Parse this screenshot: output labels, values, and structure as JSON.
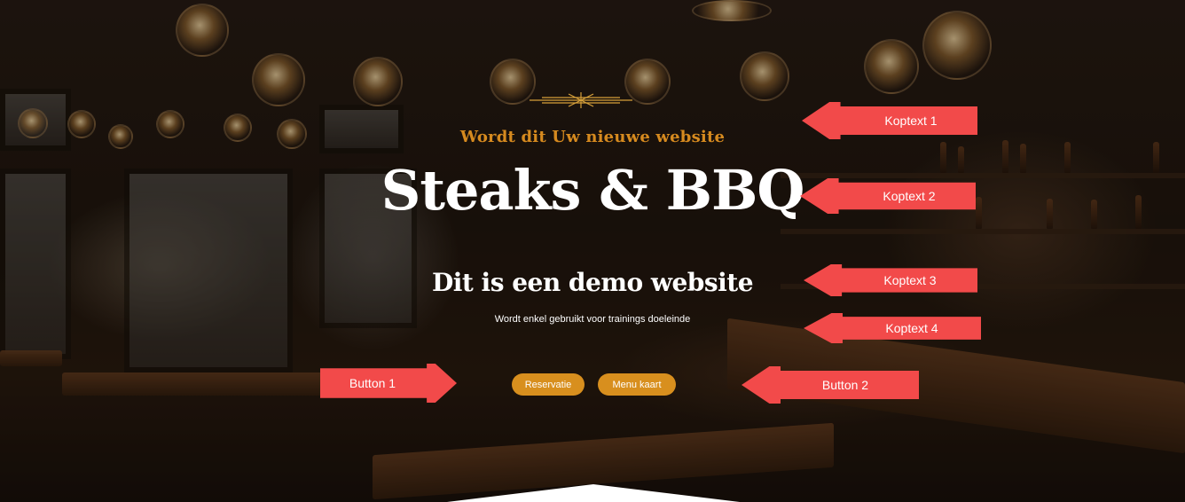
{
  "hero": {
    "kicker": "Wordt dit Uw nieuwe website",
    "headline": "Steaks & BBQ",
    "subheadline": "Dit is een demo website",
    "description": "Wordt enkel gebruikt voor trainings doeleinde",
    "accent_color": "#d68a1f"
  },
  "buttons": {
    "primary_label": "Reservatie",
    "secondary_label": "Menu kaart",
    "color": "#d88f1e"
  },
  "annotations": {
    "color": "#f24a4a",
    "koptext_1": "Koptext 1",
    "koptext_2": "Koptext 2",
    "koptext_3": "Koptext 3",
    "koptext_4": "Koptext 4",
    "button_1": "Button 1",
    "button_2": "Button 2"
  }
}
